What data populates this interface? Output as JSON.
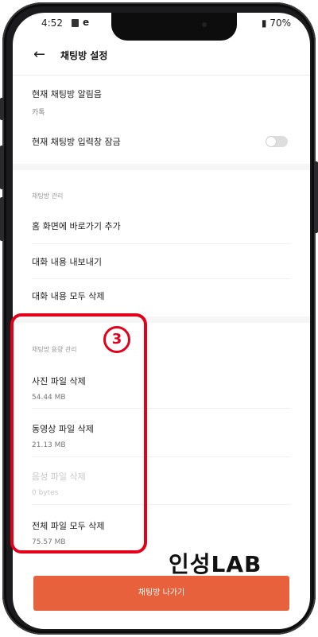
{
  "status_bar": {
    "time": "4:52",
    "app_letter": "e",
    "battery": "70%"
  },
  "header": {
    "title": "채팅방 설정"
  },
  "items": {
    "notification_sound": {
      "label": "현재 채팅방 알림음",
      "value": "카톡"
    },
    "input_lock": {
      "label": "현재 채팅방 입력창 잠금",
      "enabled": false
    }
  },
  "chatroom_management": {
    "section_label": "채팅방 관리",
    "items": [
      "홈 화면에 바로가기 추가",
      "대화 내용 내보내기",
      "대화 내용 모두 삭제"
    ]
  },
  "storage_management": {
    "section_label": "채팅방 용량 관리",
    "items": [
      {
        "label": "사진 파일 삭제",
        "size": "54.44 MB"
      },
      {
        "label": "동영상 파일 삭제",
        "size": "21.13 MB"
      },
      {
        "label": "음성 파일 삭제",
        "size": "0 bytes",
        "disabled": true
      },
      {
        "label": "전체 파일 모두 삭제",
        "size": "75.57 MB"
      }
    ]
  },
  "annotation": {
    "badge": "3",
    "color": "#e3001b"
  },
  "exit_button": {
    "label": "채팅방 나가기"
  },
  "watermark": {
    "text": "인성LAB"
  },
  "colors": {
    "accent": "#e8613d",
    "highlight": "#e3001b"
  }
}
